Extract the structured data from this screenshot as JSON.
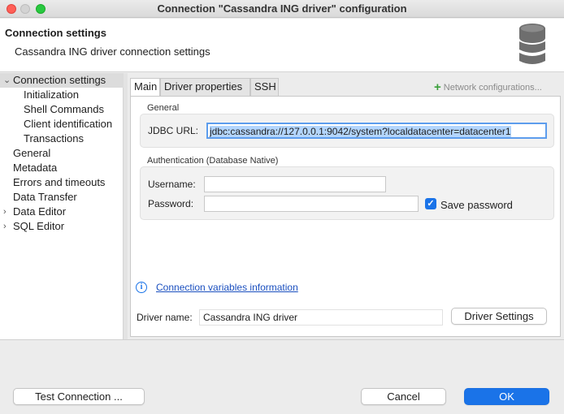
{
  "window": {
    "title": "Connection \"Cassandra ING driver\" configuration"
  },
  "header": {
    "title": "Connection settings",
    "subtitle": "Cassandra ING driver connection settings",
    "icon": "database-icon"
  },
  "nav": {
    "items": [
      {
        "label": "Connection settings",
        "expanded": true,
        "selected": true
      },
      {
        "label": "Initialization"
      },
      {
        "label": "Shell Commands"
      },
      {
        "label": "Client identification"
      },
      {
        "label": "Transactions"
      },
      {
        "label": "General"
      },
      {
        "label": "Metadata"
      },
      {
        "label": "Errors and timeouts"
      },
      {
        "label": "Data Transfer"
      },
      {
        "label": "Data Editor",
        "expandable": true
      },
      {
        "label": "SQL Editor",
        "expandable": true
      }
    ]
  },
  "tabs": [
    {
      "label": "Main",
      "active": true
    },
    {
      "label": "Driver properties"
    },
    {
      "label": "SSH"
    }
  ],
  "network_config": {
    "label": "Network configurations...",
    "icon": "plus-icon"
  },
  "general": {
    "section_label": "General",
    "jdbc_label": "JDBC URL:",
    "jdbc_value": "jdbc:cassandra://127.0.0.1:9042/system?localdatacenter=datacenter1"
  },
  "auth": {
    "section_label": "Authentication (Database Native)",
    "username_label": "Username:",
    "username_value": "",
    "password_label": "Password:",
    "password_value": "",
    "save_password_label": "Save password",
    "save_password_checked": true
  },
  "variables_link": "Connection variables information",
  "driver": {
    "label": "Driver name:",
    "value": "Cassandra ING driver",
    "settings_button": "Driver Settings"
  },
  "footer": {
    "test_button": "Test Connection ...",
    "cancel_button": "Cancel",
    "ok_button": "OK"
  },
  "colors": {
    "accent": "#1a73e8",
    "link": "#1a4fbf",
    "plus": "#3aa03a"
  }
}
